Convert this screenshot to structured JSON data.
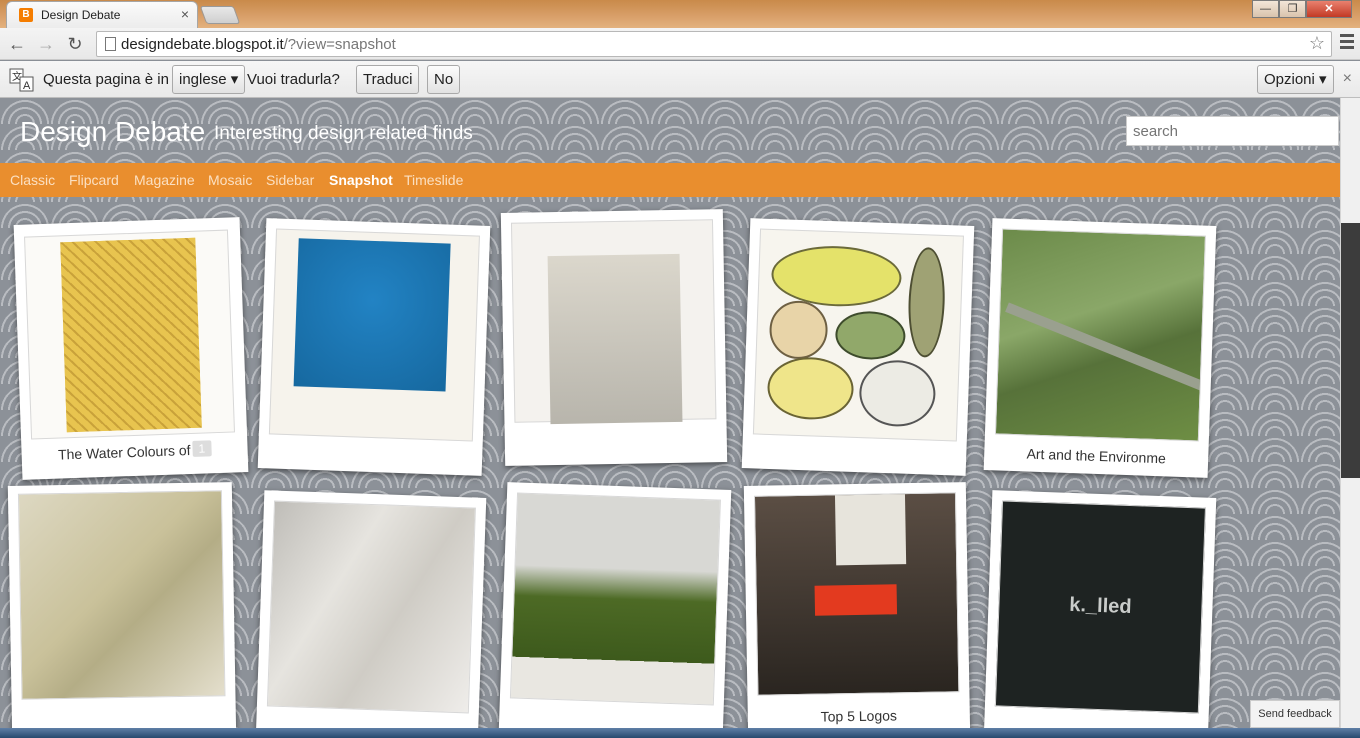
{
  "browser": {
    "tab_title": "Design Debate",
    "tab_favicon": "B",
    "tab_close": "×",
    "url_main": "designdebate.blogspot.it",
    "url_rest": "/?view=snapshot",
    "nav": {
      "back": "←",
      "forward": "→",
      "reload": "↻",
      "star": "☆"
    },
    "window_buttons": {
      "minimize": "—",
      "maximize": "❐",
      "close": "✕"
    }
  },
  "translate": {
    "prefix": "Questa pagina è in",
    "language": "inglese ▾",
    "question": "Vuoi tradurla?",
    "translate_btn": "Traduci",
    "no_btn": "No",
    "options_btn": "Opzioni ▾",
    "close": "×"
  },
  "blog": {
    "title": "Design Debate",
    "description": "Interesting design related finds",
    "search_placeholder": "search"
  },
  "views": [
    {
      "label": "Classic",
      "active": false
    },
    {
      "label": "Flipcard",
      "active": false
    },
    {
      "label": "Magazine",
      "active": false
    },
    {
      "label": "Mosaic",
      "active": false
    },
    {
      "label": "Sidebar",
      "active": false
    },
    {
      "label": "Snapshot",
      "active": true
    },
    {
      "label": "Timeslide",
      "active": false
    }
  ],
  "cards": [
    {
      "caption": "The Water Colours of",
      "comments": "1",
      "bg": "#e7c34d",
      "rot": -2
    },
    {
      "caption": "",
      "comments": "",
      "bg": "#1a76b3",
      "rot": 2
    },
    {
      "caption": "",
      "comments": "",
      "bg": "#c9c7be",
      "rot": -1
    },
    {
      "caption": "",
      "comments": "",
      "bg": "#d9d79a",
      "rot": 2
    },
    {
      "caption": "Art and the Environme",
      "comments": "",
      "bg": "#5f8a3a",
      "rot": 2
    },
    {
      "caption": "",
      "comments": "",
      "bg": "#b8b28a",
      "rot": -1
    },
    {
      "caption": "",
      "comments": "",
      "bg": "#dcdbd5",
      "rot": 2
    },
    {
      "caption": "",
      "comments": "",
      "bg": "#4d6a25",
      "rot": 2
    },
    {
      "caption": "Top 5 Logos",
      "comments": "",
      "bg": "#3b332c",
      "rot": -1
    },
    {
      "caption": "",
      "comments": "",
      "bg": "#1e2322",
      "logo_text": "k._lled",
      "rot": 2
    }
  ],
  "feedback": "Send feedback"
}
